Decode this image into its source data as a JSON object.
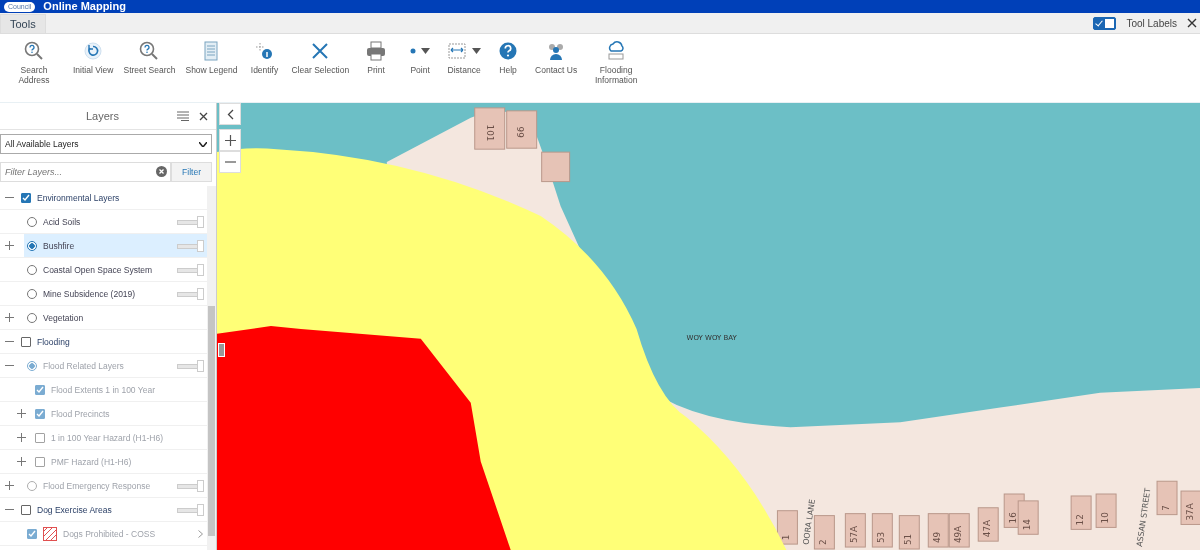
{
  "header": {
    "logo_text": "Council",
    "title": "Online Mapping"
  },
  "tabs": [
    {
      "label": "Tools",
      "selected": true
    }
  ],
  "tool_labels": {
    "label": "Tool Labels",
    "on": true
  },
  "toolbar": [
    {
      "label": "Search Address"
    },
    {
      "label": "Initial View"
    },
    {
      "label": "Street Search"
    },
    {
      "label": "Show Legend"
    },
    {
      "label": "Identify"
    },
    {
      "label": "Clear Selection"
    },
    {
      "label": "Print"
    },
    {
      "label": "Point",
      "dropdown": true
    },
    {
      "label": "Distance",
      "dropdown": true
    },
    {
      "label": "Help"
    },
    {
      "label": "Contact Us"
    },
    {
      "label": "Flooding Information"
    }
  ],
  "layers_panel": {
    "title": "Layers",
    "dropdown_value": "All Available Layers",
    "filter_placeholder": "Filter Layers...",
    "filter_button": "Filter",
    "tree": [
      {
        "kind": "group",
        "label": "Environmental Layers",
        "checked": true,
        "expanded": true,
        "children": [
          {
            "kind": "radio",
            "label": "Acid Soils",
            "selected": false,
            "level": 1
          },
          {
            "kind": "radio",
            "label": "Bushfire",
            "selected": true,
            "expanded": false,
            "level": 1
          },
          {
            "kind": "radio",
            "label": "Coastal Open Space System",
            "selected": false,
            "level": 1
          },
          {
            "kind": "radio",
            "label": "Mine Subsidence (2019)",
            "selected": false,
            "level": 1
          },
          {
            "kind": "radio",
            "label": "Vegetation",
            "selected": false,
            "expanded": false
          }
        ]
      },
      {
        "kind": "group",
        "label": "Flooding",
        "checked": false,
        "expanded": true,
        "children": [
          {
            "kind": "radio",
            "label": "Flood Related Layers",
            "selected": true,
            "disabled": true,
            "expanded": true,
            "level": 1,
            "children": [
              {
                "kind": "checkbox",
                "label": "Flood Extents 1 in 100 Year",
                "checked": true,
                "disabled": true
              },
              {
                "kind": "checkbox",
                "label": "Flood Precincts",
                "checked": true,
                "disabled": true,
                "expanded": false
              },
              {
                "kind": "checkbox",
                "label": "1 in 100 Year Hazard (H1-H6)",
                "checked": false,
                "disabled": true,
                "expanded": false
              },
              {
                "kind": "checkbox",
                "label": "PMF Hazard (H1-H6)",
                "checked": false,
                "disabled": true,
                "expanded": false
              }
            ]
          },
          {
            "kind": "radio",
            "label": "Flood Emergency Response",
            "selected": false,
            "disabled": true,
            "expanded": false,
            "level": 1
          }
        ]
      },
      {
        "kind": "group",
        "label": "Dog Exercise Areas",
        "checked": false,
        "expanded": true,
        "level": 1,
        "children": [
          {
            "kind": "legend",
            "label": "Dogs Prohibited - COSS",
            "checked": true,
            "disabled": true,
            "color": "#e05050"
          }
        ]
      }
    ]
  },
  "map": {
    "water_label": "WOY WOY BAY",
    "street_labels": [
      "OORA LANE",
      "ASSAN STREET"
    ],
    "house_numbers": [
      "101",
      "99",
      "1",
      "2",
      "57A",
      "53",
      "51",
      "49",
      "49A",
      "47A",
      "16",
      "14",
      "12",
      "10",
      "7",
      "37A"
    ]
  }
}
